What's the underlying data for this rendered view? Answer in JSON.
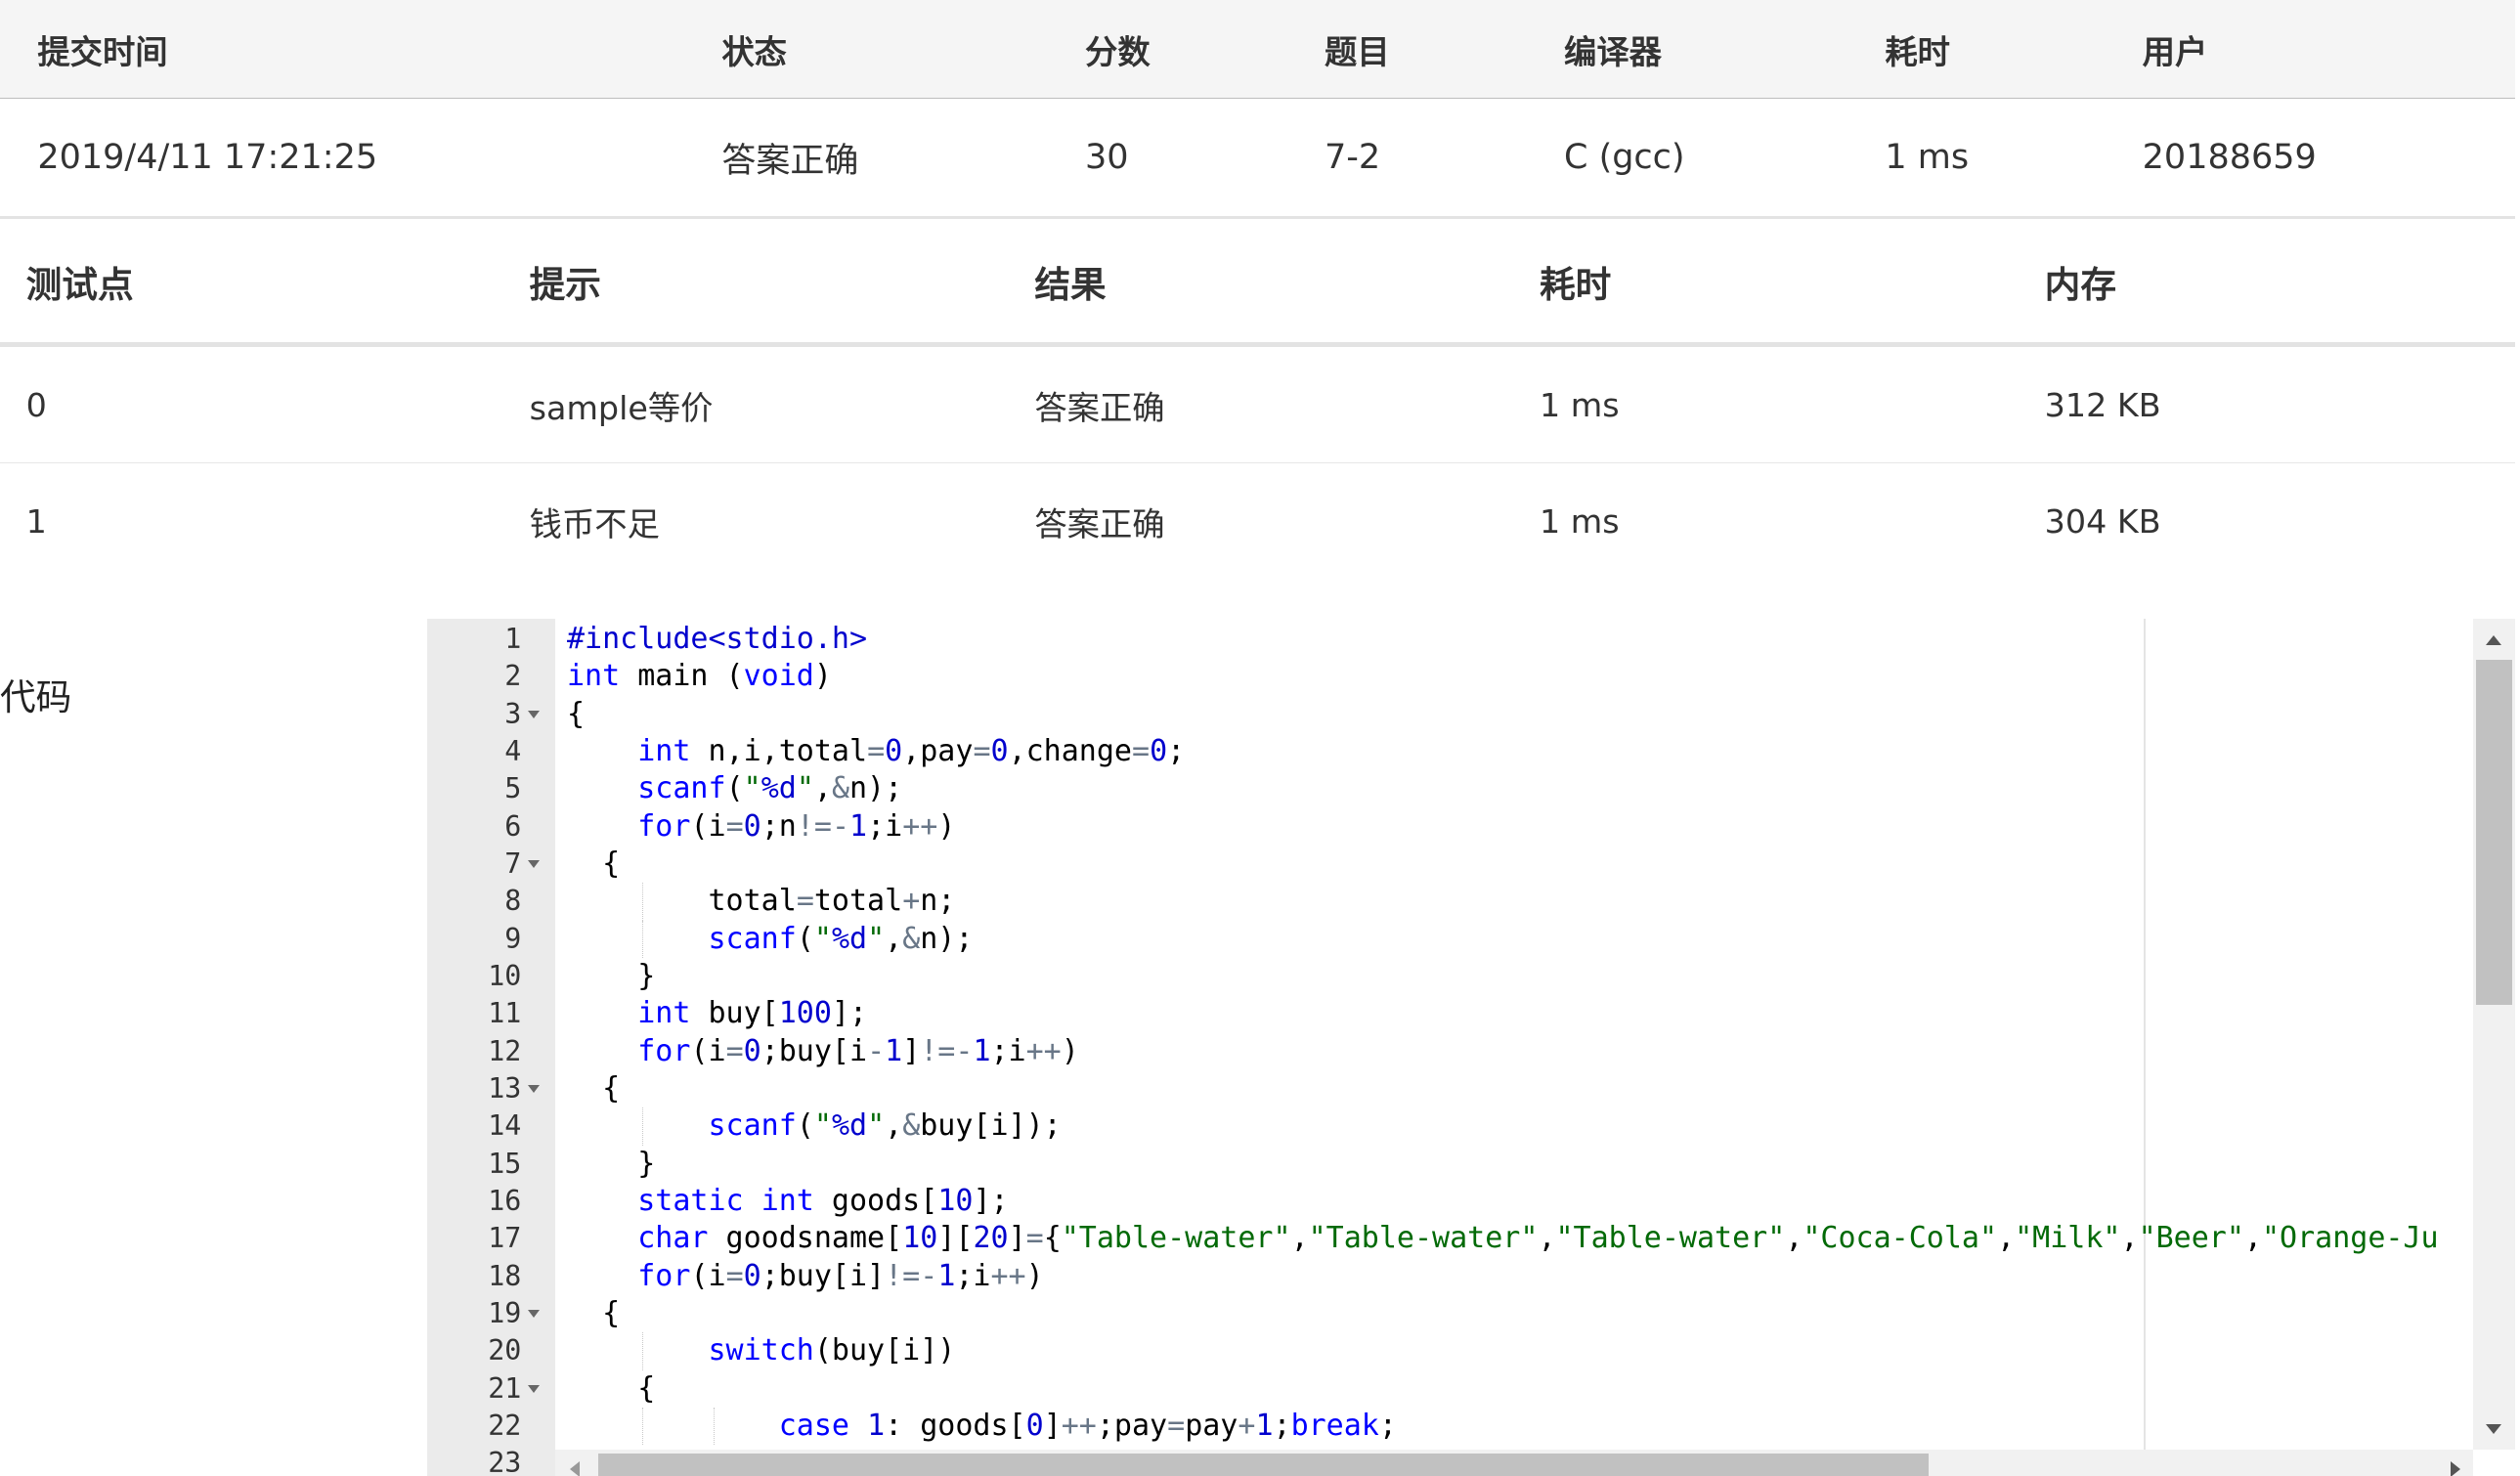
{
  "submission": {
    "headers": [
      "提交时间",
      "状态",
      "分数",
      "题目",
      "编译器",
      "耗时",
      "用户"
    ],
    "row": {
      "time": "2019/4/11 17:21:25",
      "status": "答案正确",
      "score": "30",
      "problem": "7-2",
      "compiler": "C (gcc)",
      "duration": "1 ms",
      "user": "20188659"
    }
  },
  "testcases": {
    "headers": [
      "测试点",
      "提示",
      "结果",
      "耗时",
      "内存"
    ],
    "rows": [
      {
        "id": "0",
        "hint": "sample等价",
        "result": "答案正确",
        "time": "1 ms",
        "memory": "312 KB"
      },
      {
        "id": "1",
        "hint": "钱币不足",
        "result": "答案正确",
        "time": "1 ms",
        "memory": "304 KB"
      }
    ]
  },
  "code_label": "代码",
  "code": {
    "fold_lines": [
      3,
      7,
      13,
      19,
      21
    ],
    "lines": [
      [
        [
          "d",
          "#include<stdio.h>"
        ]
      ],
      [
        [
          "k",
          "int"
        ],
        [
          "",
          " main ("
        ],
        [
          "k",
          "void"
        ],
        [
          "",
          ")"
        ]
      ],
      [
        [
          "",
          "{"
        ]
      ],
      [
        [
          "",
          "    "
        ],
        [
          "k",
          "int"
        ],
        [
          "",
          " n,i,total"
        ],
        [
          "o",
          "="
        ],
        [
          "n",
          "0"
        ],
        [
          "",
          ",pay"
        ],
        [
          "o",
          "="
        ],
        [
          "n",
          "0"
        ],
        [
          "",
          ",change"
        ],
        [
          "o",
          "="
        ],
        [
          "n",
          "0"
        ],
        [
          "",
          ";"
        ]
      ],
      [
        [
          "",
          "    "
        ],
        [
          "k",
          "scanf"
        ],
        [
          "",
          "("
        ],
        [
          "s",
          "\""
        ],
        [
          "n",
          "%d"
        ],
        [
          "s",
          "\""
        ],
        [
          "",
          ","
        ],
        [
          "o",
          "&"
        ],
        [
          "",
          "n);"
        ]
      ],
      [
        [
          "",
          "    "
        ],
        [
          "k",
          "for"
        ],
        [
          "",
          "(i"
        ],
        [
          "o",
          "="
        ],
        [
          "n",
          "0"
        ],
        [
          "",
          ";n"
        ],
        [
          "o",
          "!="
        ],
        [
          "o",
          "-"
        ],
        [
          "n",
          "1"
        ],
        [
          "",
          ";i"
        ],
        [
          "o",
          "++"
        ],
        [
          "",
          ")"
        ]
      ],
      [
        [
          "",
          "  {"
        ]
      ],
      [
        [
          "",
          "        total"
        ],
        [
          "o",
          "="
        ],
        [
          "",
          "total"
        ],
        [
          "o",
          "+"
        ],
        [
          "",
          "n;"
        ]
      ],
      [
        [
          "",
          "        "
        ],
        [
          "k",
          "scanf"
        ],
        [
          "",
          "("
        ],
        [
          "s",
          "\""
        ],
        [
          "n",
          "%d"
        ],
        [
          "s",
          "\""
        ],
        [
          "",
          ","
        ],
        [
          "o",
          "&"
        ],
        [
          "",
          "n);"
        ]
      ],
      [
        [
          "",
          "    }"
        ]
      ],
      [
        [
          "",
          "    "
        ],
        [
          "k",
          "int"
        ],
        [
          "",
          " buy["
        ],
        [
          "n",
          "100"
        ],
        [
          "",
          "];"
        ]
      ],
      [
        [
          "",
          "    "
        ],
        [
          "k",
          "for"
        ],
        [
          "",
          "(i"
        ],
        [
          "o",
          "="
        ],
        [
          "n",
          "0"
        ],
        [
          "",
          ";buy[i"
        ],
        [
          "o",
          "-"
        ],
        [
          "n",
          "1"
        ],
        [
          "",
          "]"
        ],
        [
          "o",
          "!="
        ],
        [
          "o",
          "-"
        ],
        [
          "n",
          "1"
        ],
        [
          "",
          ";i"
        ],
        [
          "o",
          "++"
        ],
        [
          "",
          ")"
        ]
      ],
      [
        [
          "",
          "  {"
        ]
      ],
      [
        [
          "",
          "        "
        ],
        [
          "k",
          "scanf"
        ],
        [
          "",
          "("
        ],
        [
          "s",
          "\""
        ],
        [
          "n",
          "%d"
        ],
        [
          "s",
          "\""
        ],
        [
          "",
          ","
        ],
        [
          "o",
          "&"
        ],
        [
          "",
          "buy[i]);"
        ]
      ],
      [
        [
          "",
          "    }"
        ]
      ],
      [
        [
          "",
          "    "
        ],
        [
          "k",
          "static"
        ],
        [
          "",
          " "
        ],
        [
          "k",
          "int"
        ],
        [
          "",
          " goods["
        ],
        [
          "n",
          "10"
        ],
        [
          "",
          "];"
        ]
      ],
      [
        [
          "",
          "    "
        ],
        [
          "k",
          "char"
        ],
        [
          "",
          " goodsname["
        ],
        [
          "n",
          "10"
        ],
        [
          "",
          "]["
        ],
        [
          "n",
          "20"
        ],
        [
          "",
          "]"
        ],
        [
          "o",
          "="
        ],
        [
          "",
          "{"
        ],
        [
          "s",
          "\"Table-water\""
        ],
        [
          "",
          ","
        ],
        [
          "s",
          "\"Table-water\""
        ],
        [
          "",
          ","
        ],
        [
          "s",
          "\"Table-water\""
        ],
        [
          "",
          ","
        ],
        [
          "s",
          "\"Coca-Cola\""
        ],
        [
          "",
          ","
        ],
        [
          "s",
          "\"Milk\""
        ],
        [
          "",
          ","
        ],
        [
          "s",
          "\"Beer\""
        ],
        [
          "",
          ","
        ],
        [
          "s",
          "\"Orange-Ju"
        ]
      ],
      [
        [
          "",
          "    "
        ],
        [
          "k",
          "for"
        ],
        [
          "",
          "(i"
        ],
        [
          "o",
          "="
        ],
        [
          "n",
          "0"
        ],
        [
          "",
          ";buy[i]"
        ],
        [
          "o",
          "!="
        ],
        [
          "o",
          "-"
        ],
        [
          "n",
          "1"
        ],
        [
          "",
          ";i"
        ],
        [
          "o",
          "++"
        ],
        [
          "",
          ")"
        ]
      ],
      [
        [
          "",
          "  {"
        ]
      ],
      [
        [
          "",
          "        "
        ],
        [
          "k",
          "switch"
        ],
        [
          "",
          "(buy[i])"
        ]
      ],
      [
        [
          "",
          "    {"
        ]
      ],
      [
        [
          "",
          "            "
        ],
        [
          "k",
          "case"
        ],
        [
          "",
          " "
        ],
        [
          "n",
          "1"
        ],
        [
          "",
          ": goods["
        ],
        [
          "n",
          "0"
        ],
        [
          "",
          "]"
        ],
        [
          "o",
          "++"
        ],
        [
          "",
          ";pay"
        ],
        [
          "o",
          "="
        ],
        [
          "",
          "pay"
        ],
        [
          "o",
          "+"
        ],
        [
          "n",
          "1"
        ],
        [
          "",
          ";"
        ],
        [
          "k",
          "break"
        ],
        [
          "",
          ";"
        ]
      ],
      [
        [
          "",
          ""
        ]
      ]
    ]
  },
  "colors": {
    "status_ok": "#e53935",
    "link": "#1f4f9e",
    "keyword": "#0000ff",
    "string": "#036a07",
    "number": "#0000cd"
  }
}
